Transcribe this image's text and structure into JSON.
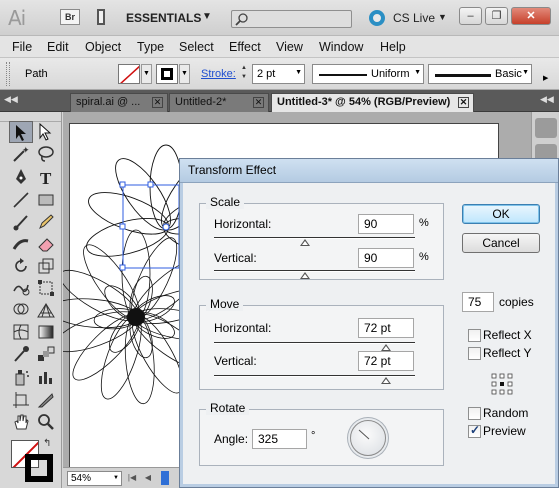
{
  "appbar": {
    "logo": "Ai",
    "bridge_label": "Br",
    "workspace": "ESSENTIALS",
    "search_placeholder": "",
    "cslive": "CS Live",
    "window_buttons": {
      "minimize": "–",
      "restore": "❐",
      "close": "✕"
    }
  },
  "menu": [
    "File",
    "Edit",
    "Object",
    "Type",
    "Select",
    "Effect",
    "View",
    "Window",
    "Help"
  ],
  "control": {
    "object_type": "Path",
    "stroke_label": "Stroke:",
    "stroke_weight": "2 pt",
    "variable_width": "Uniform",
    "brush": "Basic"
  },
  "tabs": [
    {
      "label": "spiral.ai @ ...",
      "active": false
    },
    {
      "label": "Untitled-2*",
      "active": false
    },
    {
      "label": "Untitled-3* @ 54% (RGB/Preview)",
      "active": true
    }
  ],
  "status": {
    "zoom": "54%"
  },
  "dialog": {
    "title": "Transform Effect",
    "scale": {
      "legend": "Scale",
      "horizontal_label": "Horizontal:",
      "horizontal_value": "90",
      "horizontal_unit": "%",
      "vertical_label": "Vertical:",
      "vertical_value": "90",
      "vertical_unit": "%"
    },
    "move": {
      "legend": "Move",
      "horizontal_label": "Horizontal:",
      "horizontal_value": "72 pt",
      "vertical_label": "Vertical:",
      "vertical_value": "72 pt"
    },
    "rotate": {
      "legend": "Rotate",
      "angle_label": "Angle:",
      "angle_value": "325",
      "angle_unit": "°"
    },
    "ok": "OK",
    "cancel": "Cancel",
    "copies_value": "75",
    "copies_label": "copies",
    "reflect_x": {
      "label": "Reflect X",
      "checked": false
    },
    "reflect_y": {
      "label": "Reflect Y",
      "checked": false
    },
    "random": {
      "label": "Random",
      "checked": false
    },
    "preview": {
      "label": "Preview",
      "checked": true
    }
  }
}
